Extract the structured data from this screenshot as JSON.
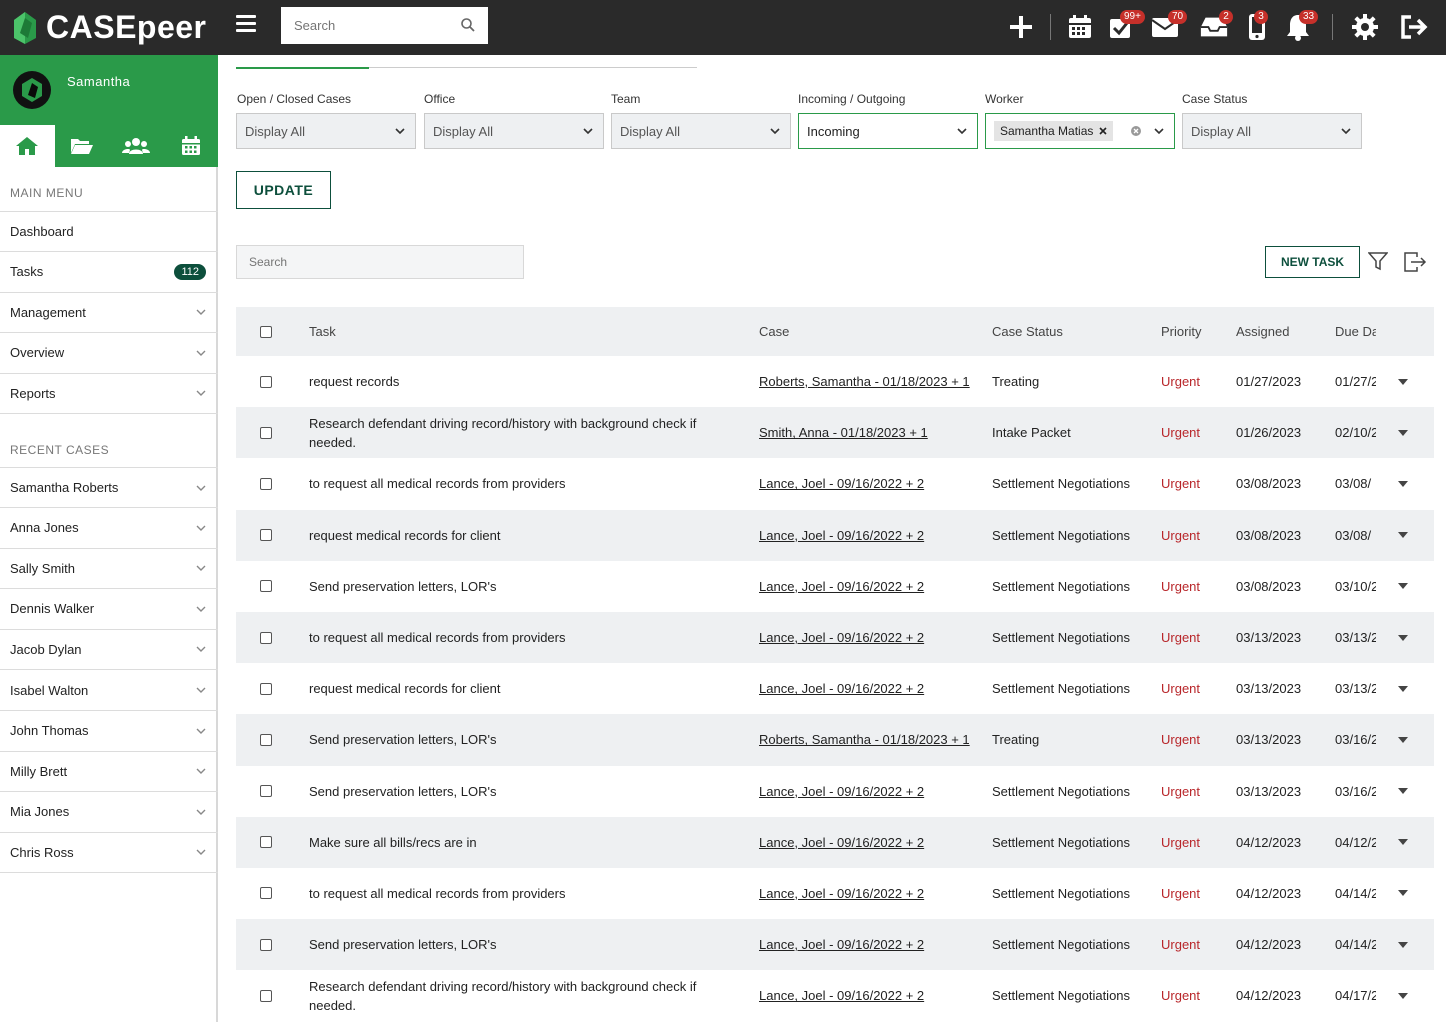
{
  "app": {
    "name": "CASEpeer"
  },
  "topbar": {
    "search_placeholder": "Search",
    "badges": {
      "tasks": "99+",
      "mail": "70",
      "inbox": "2",
      "phone": "3",
      "notifications": "33"
    }
  },
  "sidebar": {
    "user_name": "Samantha",
    "main_menu_title": "MAIN MENU",
    "main_items": [
      {
        "label": "Dashboard"
      },
      {
        "label": "Tasks",
        "badge": "112"
      },
      {
        "label": "Management"
      },
      {
        "label": "Overview"
      },
      {
        "label": "Reports"
      }
    ],
    "recent_title": "RECENT CASES",
    "recent_items": [
      {
        "label": "Samantha Roberts"
      },
      {
        "label": "Anna Jones"
      },
      {
        "label": "Sally Smith"
      },
      {
        "label": "Dennis Walker"
      },
      {
        "label": "Jacob Dylan"
      },
      {
        "label": "Isabel Walton"
      },
      {
        "label": "John Thomas"
      },
      {
        "label": "Milly Brett"
      },
      {
        "label": "Mia Jones"
      },
      {
        "label": "Chris Ross"
      }
    ]
  },
  "filters": {
    "open_closed": {
      "label": "Open / Closed Cases",
      "value": "Display All"
    },
    "office": {
      "label": "Office",
      "value": "Display All"
    },
    "team": {
      "label": "Team",
      "value": "Display All"
    },
    "incoming": {
      "label": "Incoming / Outgoing",
      "value": "Incoming"
    },
    "worker": {
      "label": "Worker",
      "value": "Samantha Matias"
    },
    "case_status": {
      "label": "Case Status",
      "value": "Display All"
    },
    "update_label": "UPDATE"
  },
  "tasks": {
    "search_placeholder": "Search",
    "new_task_label": "NEW TASK",
    "columns": {
      "task": "Task",
      "case": "Case",
      "status": "Case Status",
      "priority": "Priority",
      "assigned": "Assigned",
      "due": "Due Da"
    },
    "rows": [
      {
        "task": "request records",
        "case": "Roberts, Samantha - 01/18/2023 + 1",
        "status": "Treating",
        "priority": "Urgent",
        "assigned": "01/27/2023",
        "due": "01/27/2"
      },
      {
        "task": "Research defendant driving record/history with background check if needed.",
        "case": "Smith, Anna - 01/18/2023 + 1",
        "status": "Intake Packet",
        "priority": "Urgent",
        "assigned": "01/26/2023",
        "due": "02/10/2"
      },
      {
        "task": "to request all medical records from providers",
        "case": "Lance, Joel - 09/16/2022 + 2",
        "status": "Settlement Negotiations",
        "priority": "Urgent",
        "assigned": "03/08/2023",
        "due": "03/08/"
      },
      {
        "task": "request medical records for client",
        "case": "Lance, Joel - 09/16/2022 + 2",
        "status": "Settlement Negotiations",
        "priority": "Urgent",
        "assigned": "03/08/2023",
        "due": "03/08/"
      },
      {
        "task": "Send preservation letters, LOR's",
        "case": "Lance, Joel - 09/16/2022 + 2",
        "status": "Settlement Negotiations",
        "priority": "Urgent",
        "assigned": "03/08/2023",
        "due": "03/10/2"
      },
      {
        "task": "to request all medical records from providers",
        "case": "Lance, Joel - 09/16/2022 + 2",
        "status": "Settlement Negotiations",
        "priority": "Urgent",
        "assigned": "03/13/2023",
        "due": "03/13/2"
      },
      {
        "task": "request medical records for client",
        "case": "Lance, Joel - 09/16/2022 + 2",
        "status": "Settlement Negotiations",
        "priority": "Urgent",
        "assigned": "03/13/2023",
        "due": "03/13/2"
      },
      {
        "task": "Send preservation letters, LOR's",
        "case": "Roberts, Samantha - 01/18/2023 + 1",
        "status": "Treating",
        "priority": "Urgent",
        "assigned": "03/13/2023",
        "due": "03/16/2"
      },
      {
        "task": "Send preservation letters, LOR's",
        "case": "Lance, Joel - 09/16/2022 + 2",
        "status": "Settlement Negotiations",
        "priority": "Urgent",
        "assigned": "03/13/2023",
        "due": "03/16/2"
      },
      {
        "task": "Make sure all bills/recs are in",
        "case": "Lance, Joel - 09/16/2022 + 2",
        "status": "Settlement Negotiations",
        "priority": "Urgent",
        "assigned": "04/12/2023",
        "due": "04/12/2"
      },
      {
        "task": "to request all medical records from providers",
        "case": "Lance, Joel - 09/16/2022 + 2",
        "status": "Settlement Negotiations",
        "priority": "Urgent",
        "assigned": "04/12/2023",
        "due": "04/14/2"
      },
      {
        "task": "Send preservation letters, LOR's",
        "case": "Lance, Joel - 09/16/2022 + 2",
        "status": "Settlement Negotiations",
        "priority": "Urgent",
        "assigned": "04/12/2023",
        "due": "04/14/2"
      },
      {
        "task": "Research defendant driving record/history with background check if needed.",
        "case": "Lance, Joel - 09/16/2022 + 2",
        "status": "Settlement Negotiations",
        "priority": "Urgent",
        "assigned": "04/12/2023",
        "due": "04/17/2"
      }
    ]
  }
}
